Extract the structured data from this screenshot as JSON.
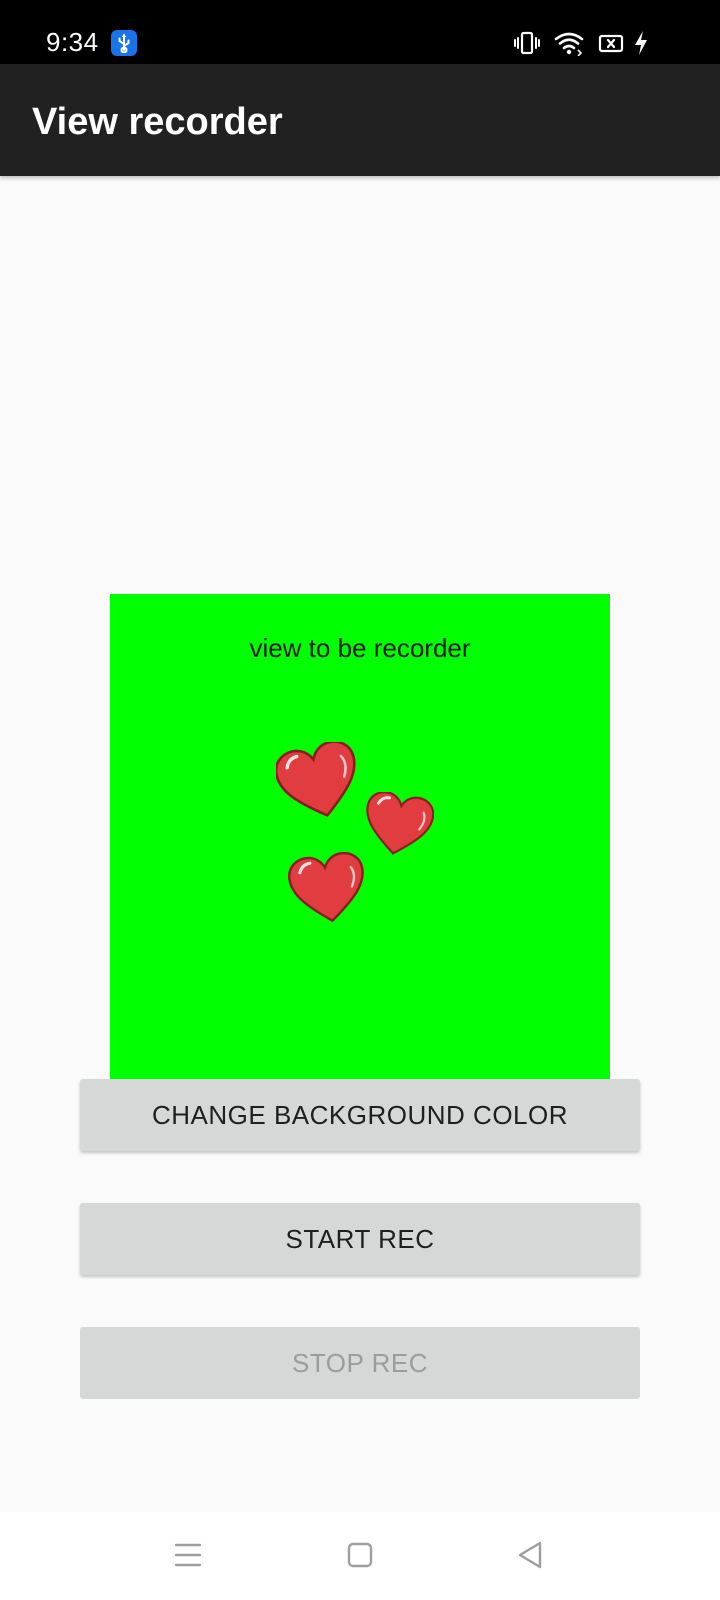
{
  "status_bar": {
    "time": "9:34",
    "icons": [
      "usb-icon",
      "vibrate-icon",
      "wifi-icon",
      "screen-record-icon",
      "charging-icon"
    ],
    "usb_badge_color": "#1a73e8"
  },
  "app_bar": {
    "title": "View recorder",
    "background": "#212121"
  },
  "record_view": {
    "caption": "view to be recorder",
    "background": "#00ff00",
    "decoration": "hearts-image"
  },
  "buttons": {
    "change_background": "CHANGE BACKGROUND COLOR",
    "start_rec": "START REC",
    "stop_rec": "STOP REC"
  },
  "nav_bar": {
    "icons": [
      "menu-icon",
      "home-icon",
      "back-icon"
    ]
  }
}
